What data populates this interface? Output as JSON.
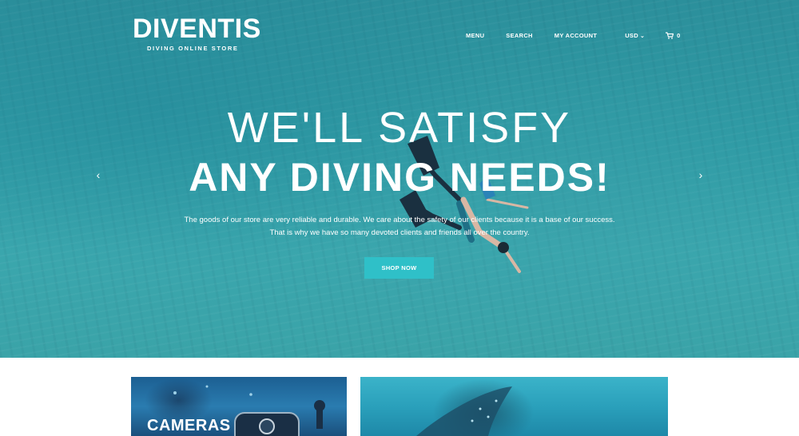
{
  "header": {
    "logo_text": "DIVENTIS",
    "logo_tagline": "DIVING ONLINE STORE",
    "nav": {
      "menu": "MENU",
      "search": "SEARCH",
      "account": "MY ACCOUNT",
      "currency": "USD",
      "cart_count": "0"
    }
  },
  "hero": {
    "title_line1": "WE'LL SATISFY",
    "title_line2": "ANY DIVING NEEDS!",
    "description_line1": "The goods of our store are very reliable and durable. We care about the safety of our clients because it is a base of our success.",
    "description_line2": "That is why we have so many devoted clients and friends all over the country.",
    "button_label": "SHOP NOW"
  },
  "categories": [
    {
      "title": "CAMERAS"
    },
    {
      "title": ""
    }
  ],
  "colors": {
    "accent": "#2fc0c8",
    "water": "#2f9ba5",
    "text_light": "#ffffff"
  },
  "icons": {
    "cart": "cart-icon",
    "chevron": "chevron-down-icon",
    "prev": "chevron-left-icon",
    "next": "chevron-right-icon"
  }
}
